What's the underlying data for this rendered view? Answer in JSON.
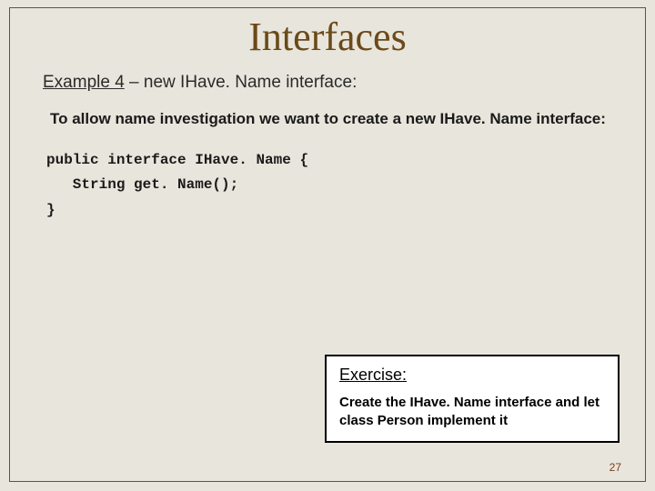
{
  "title": "Interfaces",
  "subhead_uline": "Example 4",
  "subhead_rest": " – new IHave. Name interface:",
  "description": "To allow name investigation we want to create a new IHave. Name interface:",
  "code_line1": "public interface IHave. Name {",
  "code_line2": "   String get. Name();",
  "code_line3": "}",
  "exercise_title": "Exercise:",
  "exercise_body": "Create the IHave. Name interface and let class Person implement it",
  "page_number": "27"
}
